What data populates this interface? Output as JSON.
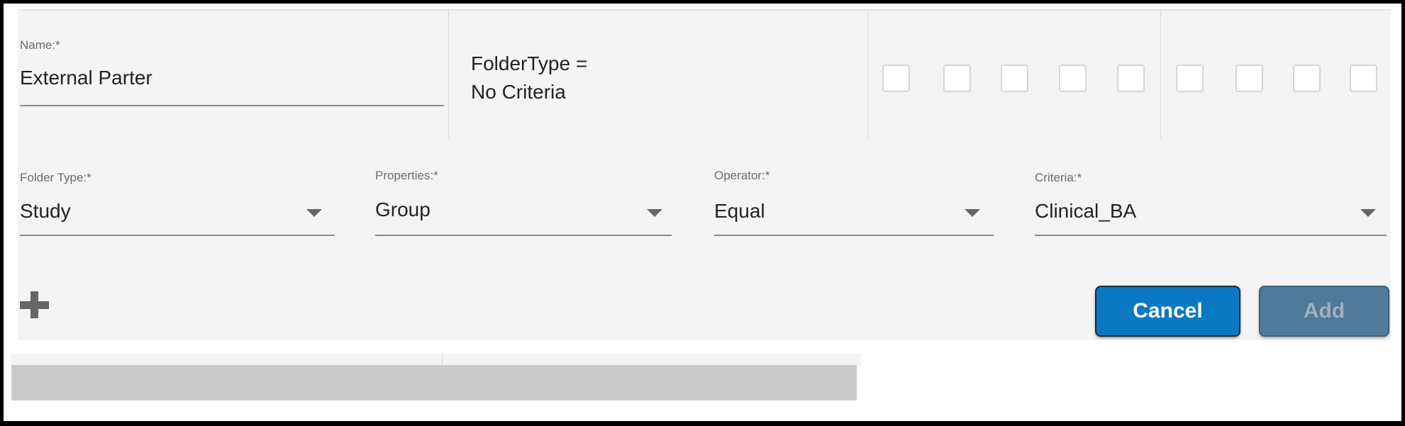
{
  "name_field": {
    "label": "Name:*",
    "value": "External Parter"
  },
  "summary": {
    "line1": "FolderType =",
    "line2": "No Criteria"
  },
  "checkbox_count": 9,
  "fields": [
    {
      "label": "Folder Type:*",
      "value": "Study"
    },
    {
      "label": "Properties:*",
      "value": "Group"
    },
    {
      "label": "Operator:*",
      "value": "Equal"
    },
    {
      "label": "Criteria:*",
      "value": "Clinical_BA"
    }
  ],
  "actions": {
    "add_row_icon": "plus-icon",
    "cancel_label": "Cancel",
    "add_label": "Add"
  },
  "colors": {
    "cancel": "#0a78c2",
    "add_disabled": "#4f7a99",
    "panel": "#f4f4f4"
  }
}
